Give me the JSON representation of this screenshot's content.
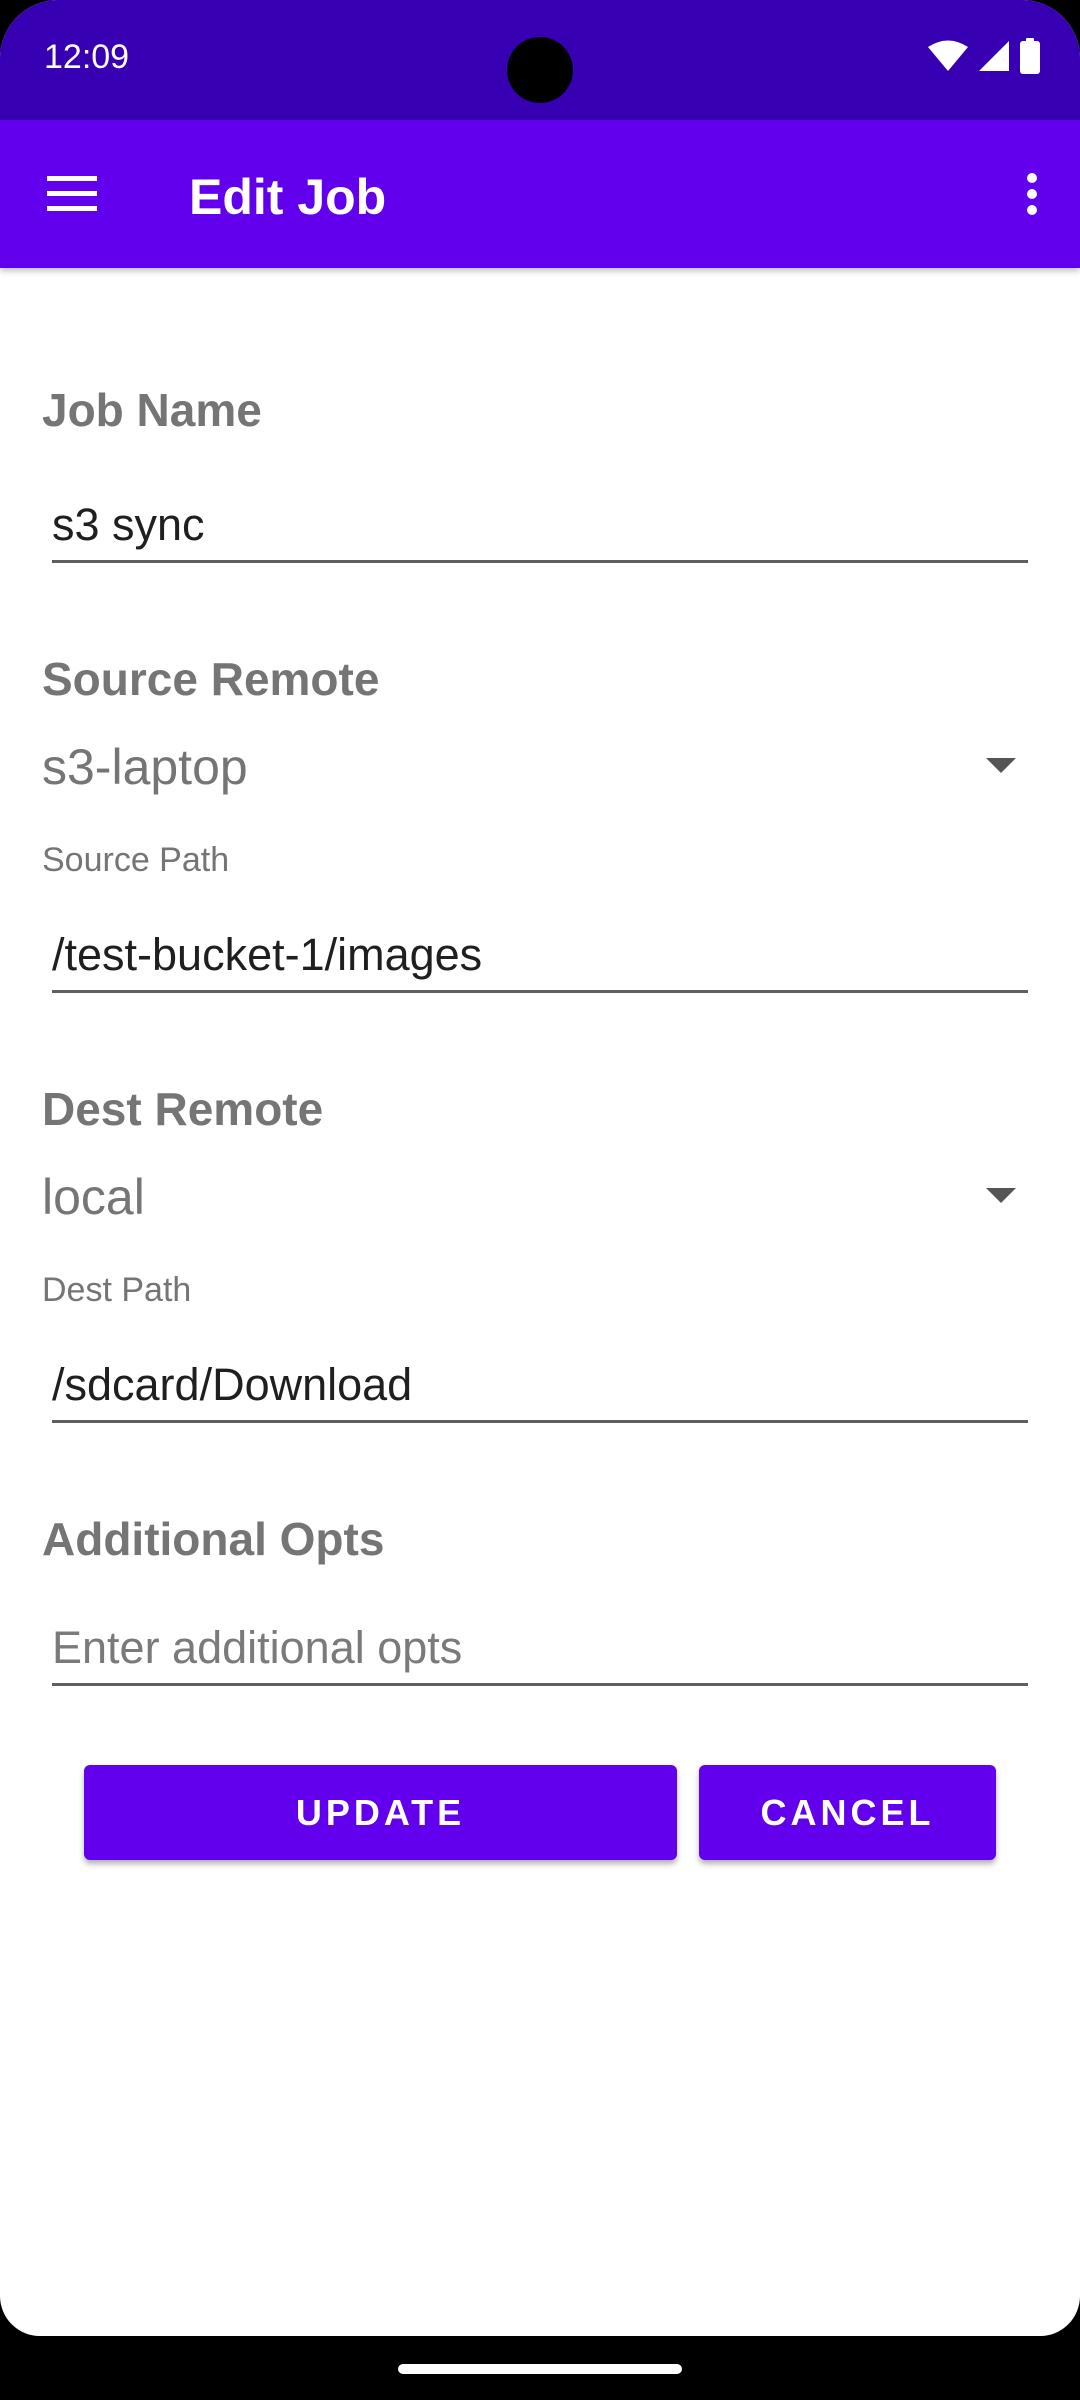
{
  "status_bar": {
    "time": "12:09",
    "background": "#3700b3",
    "icons": [
      "wifi-icon",
      "signal-icon",
      "battery-icon"
    ]
  },
  "app_bar": {
    "title": "Edit Job",
    "background": "#6200ee",
    "menu_icon": "hamburger-menu-icon",
    "overflow_icon": "more-vert-icon"
  },
  "form": {
    "job_name": {
      "label": "Job Name",
      "value": "s3 sync"
    },
    "source_remote": {
      "label": "Source Remote",
      "selected": "s3-laptop"
    },
    "source_path": {
      "label": "Source Path",
      "value": "/test-bucket-1/images"
    },
    "dest_remote": {
      "label": "Dest Remote",
      "selected": "local"
    },
    "dest_path": {
      "label": "Dest Path",
      "value": "/sdcard/Download"
    },
    "additional_opts": {
      "label": "Additional Opts",
      "value": "",
      "placeholder": "Enter additional opts"
    }
  },
  "actions": {
    "update_label": "UPDATE",
    "cancel_label": "CANCEL",
    "accent": "#6200ee"
  }
}
